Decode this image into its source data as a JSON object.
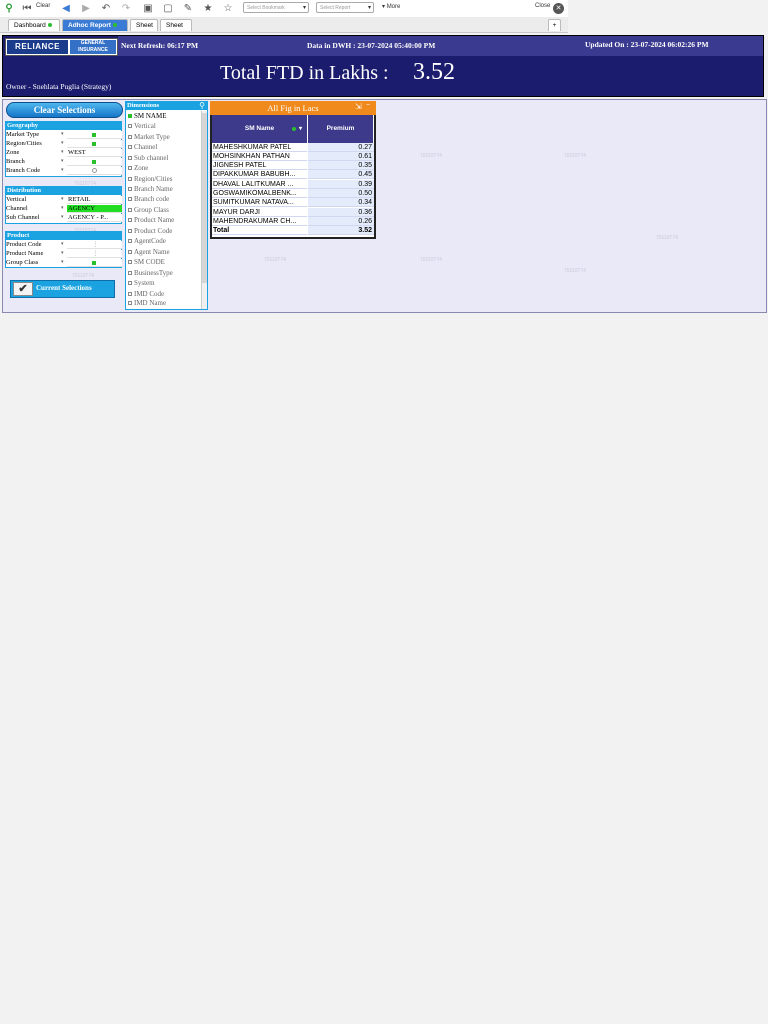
{
  "toolbar": {
    "clear_label": "Clear",
    "bookmark_placeholder": "Select Bookmark",
    "report_placeholder": "Select Report",
    "more_label": "More",
    "close_label": "Close"
  },
  "tabs": [
    {
      "label": "Dashboard"
    },
    {
      "label": "Adhoc Report"
    },
    {
      "label": "Sheet"
    },
    {
      "label": "Sheet"
    }
  ],
  "header": {
    "logo_main": "RELIANCE",
    "logo_sub1": "GENERAL",
    "logo_sub2": "INSURANCE",
    "next_refresh": "Next Refresh: 06:17 PM",
    "data_in_dwh": "Data in DWH : 23-07-2024 05:40:00 PM",
    "updated_on": "Updated On  : 23-07-2024 06:02:26 PM",
    "owner": "Owner - Snehlata Puglia (Strategy)",
    "kpi_label": "Total FTD in Lakhs :",
    "kpi_value": "3.52"
  },
  "clear_selections_label": "Clear Selections",
  "geography": {
    "title": "Geography",
    "rows": [
      {
        "label": "Market Type",
        "value": ""
      },
      {
        "label": "Region/Cities",
        "value": ""
      },
      {
        "label": "Zone",
        "value": "WEST"
      },
      {
        "label": "Branch",
        "value": ""
      },
      {
        "label": "Branch Code",
        "value": ""
      }
    ]
  },
  "distribution": {
    "title": "Distribution",
    "rows": [
      {
        "label": "Vertical",
        "value": "RETAIL"
      },
      {
        "label": "Channel",
        "value": "AGENCY"
      },
      {
        "label": "Sub Channel",
        "value": "AGENCY - P..."
      }
    ]
  },
  "product": {
    "title": "Product",
    "rows": [
      {
        "label": "Product Code",
        "value": ""
      },
      {
        "label": "Product Name",
        "value": ""
      },
      {
        "label": "Group Class",
        "value": ""
      }
    ]
  },
  "current_selections_label": "Current Selections",
  "dimensions": {
    "title": "Dimensions",
    "items": [
      "SM NAME",
      "Vertical",
      "Market Type",
      "Channel",
      "Sub channel",
      "Zone",
      "Region/Cities",
      "Branch Name",
      "Branch code",
      "Group Class",
      "Product Name",
      "Product Code",
      "AgentCode",
      "Agent Name",
      "SM CODE",
      "BusinessType",
      "System",
      "IMD Code",
      "IMD Name"
    ]
  },
  "table": {
    "title": "All Fig in Lacs",
    "col1": "SM Name",
    "col2": "Premium",
    "rows": [
      {
        "name": "MAHESHKUMAR PATEL",
        "value": "0.27"
      },
      {
        "name": "MOHSINKHAN PATHAN",
        "value": "0.61"
      },
      {
        "name": "JIGNESH PATEL",
        "value": "0.35"
      },
      {
        "name": "DIPAKKUMAR BABUBH...",
        "value": "0.45"
      },
      {
        "name": "DHAVAL LALITKUMAR ...",
        "value": "0.39"
      },
      {
        "name": "GOSWAMIKOMALBENK...",
        "value": "0.50"
      },
      {
        "name": "SUMITKUMAR NATAVA...",
        "value": "0.34"
      },
      {
        "name": "MAYUR DARJI",
        "value": "0.36"
      },
      {
        "name": "MAHENDRAKUMAR CH...",
        "value": "0.26"
      }
    ],
    "total_label": "Total",
    "total_value": "3.52"
  },
  "watermark": "70110774",
  "colors": {
    "header_bg": "#1c1c6e",
    "accent_blue": "#1aa3e0",
    "table_header": "#3d3a8c",
    "table_title": "#f08a1c",
    "selected_green": "#22dd22"
  }
}
